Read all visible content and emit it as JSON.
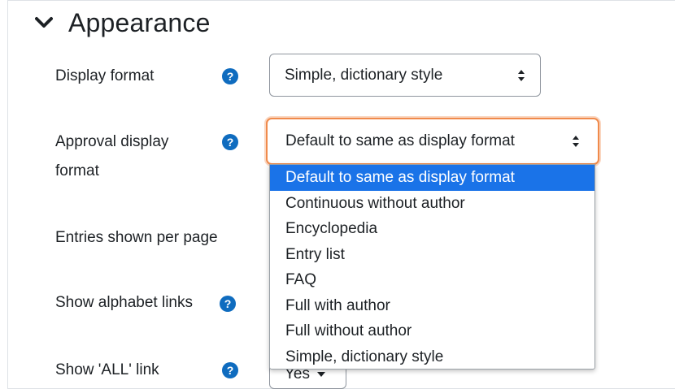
{
  "section": {
    "title": "Appearance"
  },
  "fields": {
    "display_format": {
      "label": "Display format",
      "value": "Simple, dictionary style"
    },
    "approval_display_format": {
      "label_line1": "Approval display",
      "label_line2": "format",
      "value": "Default to same as display format"
    },
    "entries_per_page": {
      "label": "Entries shown per page"
    },
    "show_alphabet_links": {
      "label": "Show alphabet links"
    },
    "show_all_link": {
      "label": "Show 'ALL' link",
      "value": "Yes"
    }
  },
  "dropdown": {
    "options": [
      "Default to same as display format",
      "Continuous without author",
      "Encyclopedia",
      "Entry list",
      "FAQ",
      "Full with author",
      "Full without author",
      "Simple, dictionary style"
    ],
    "selected_index": 0
  },
  "colors": {
    "help_icon": "#0f6cbf",
    "focus_ring": "#f08a4b",
    "selected_option_bg": "#1a73e8",
    "text": "#1d2125"
  },
  "icons": {
    "collapse": "chevron-down-icon",
    "help": "question-circle-icon",
    "select_caret": "sort-arrows-icon"
  }
}
